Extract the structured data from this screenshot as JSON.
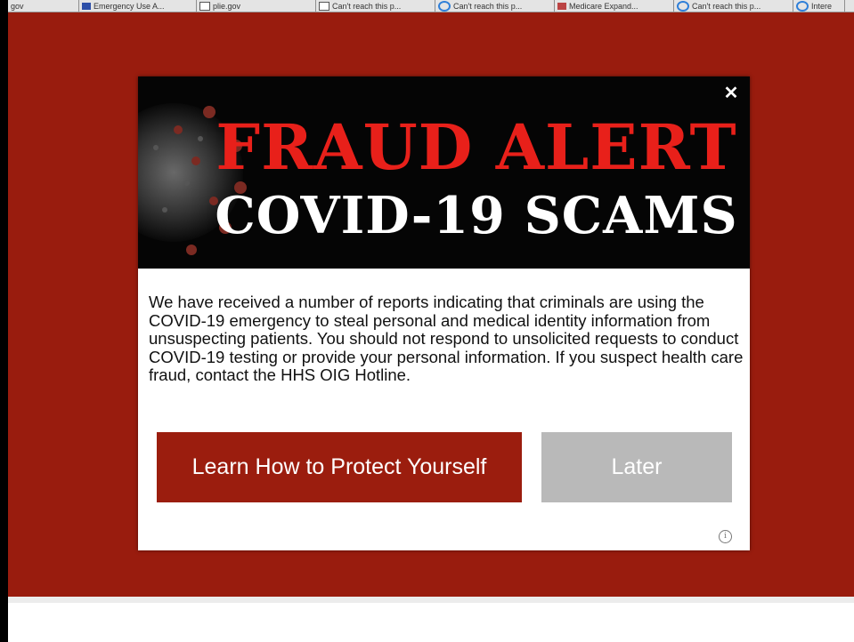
{
  "browser_tabs": [
    {
      "label": "gov",
      "icon": "none"
    },
    {
      "label": "Emergency Use A...",
      "icon": "flag-icon"
    },
    {
      "label": "plie.gov",
      "icon": "page-icon"
    },
    {
      "label": "Can't reach this p...",
      "icon": "page-icon"
    },
    {
      "label": "Can't reach this p...",
      "icon": "ie-icon"
    },
    {
      "label": "Medicare Expand...",
      "icon": "medicare-icon"
    },
    {
      "label": "Can't reach this p...",
      "icon": "ie-icon"
    },
    {
      "label": "Intere",
      "icon": "ie-icon"
    }
  ],
  "popup": {
    "headline_line1": "FRAUD ALERT",
    "headline_line2": "COVID-19 SCAMS",
    "close_glyph": "✕",
    "message": "We have received a number of reports indicating that criminals are using the COVID-19 emergency to steal personal and medical identity information from unsuspecting patients. You should not respond to unsolicited requests to conduct COVID-19 testing or provide your personal information. If you suspect health care fraud, contact the HHS OIG Hotline.",
    "primary_button": "Learn How to Protect Yourself",
    "secondary_button": "Later",
    "info_glyph": "i"
  },
  "colors": {
    "backdrop": "#991c0e",
    "primary_button": "#9b1d0e",
    "secondary_button": "#b9b9b9",
    "headline_red": "#e8201a"
  }
}
